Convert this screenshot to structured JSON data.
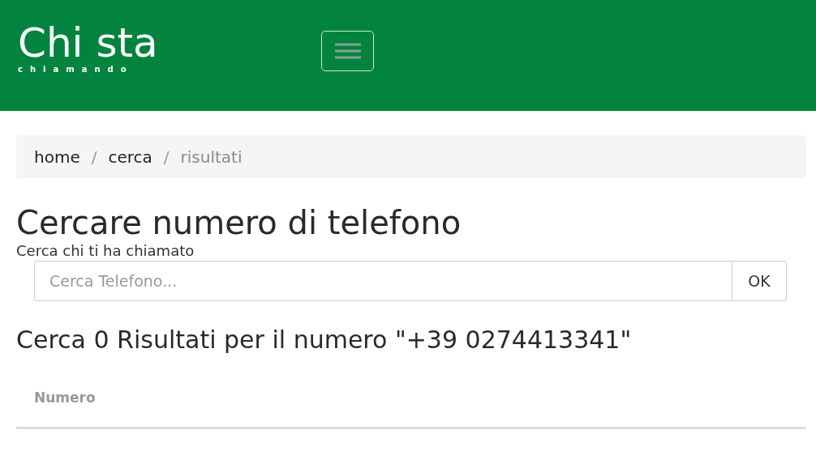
{
  "header": {
    "logo": {
      "title": "Chi sta",
      "subtitle": "chiamando"
    }
  },
  "breadcrumb": [
    {
      "label": "home",
      "active": false
    },
    {
      "label": "cerca",
      "active": false
    },
    {
      "label": "risultati",
      "active": true
    }
  ],
  "breadcrumb_separator": "/",
  "title": "Cercare numero di telefono",
  "subtitle": "Cerca chi ti ha chiamato",
  "search": {
    "placeholder": "Cerca Telefono...",
    "button": "OK"
  },
  "results_heading": "Cerca 0 Risultati per il numero \"+39 0274413341\"",
  "table": {
    "columns": [
      "Numero"
    ]
  }
}
